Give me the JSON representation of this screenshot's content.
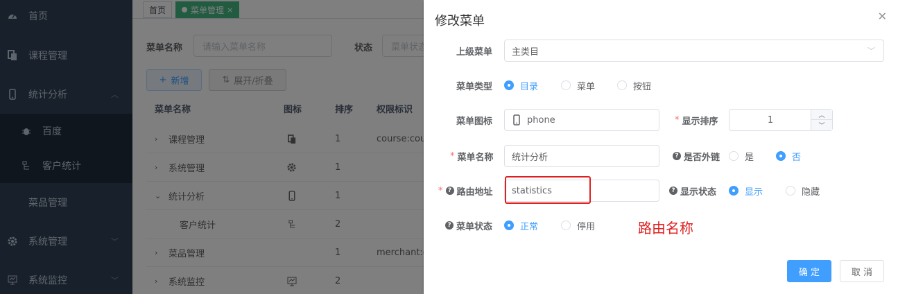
{
  "sidebar": {
    "items": [
      {
        "label": "首页",
        "icon": "dashboard-icon"
      },
      {
        "label": "课程管理",
        "icon": "copy-icon"
      },
      {
        "label": "统计分析",
        "icon": "phone-icon",
        "expanded": true
      },
      {
        "label": "百度",
        "icon": "bug-icon"
      },
      {
        "label": "客户统计",
        "icon": "tree-icon"
      },
      {
        "label": "菜品管理",
        "icon": ""
      },
      {
        "label": "系统管理",
        "icon": "gear-icon"
      },
      {
        "label": "系统监控",
        "icon": "monitor-icon"
      }
    ]
  },
  "tags": {
    "home": "首页",
    "current": "菜单管理"
  },
  "search": {
    "name_label": "菜单名称",
    "name_placeholder": "请输入菜单名称",
    "status_label": "状态",
    "status_placeholder": "菜单状态"
  },
  "toolbar": {
    "add": "新增",
    "expand": "展开/折叠"
  },
  "table": {
    "headers": [
      "菜单名称",
      "图标",
      "排序",
      "权限标识"
    ],
    "rows": [
      {
        "name": "课程管理",
        "icon": "copy-icon",
        "order": "1",
        "perm": "course:cou",
        "expand": ">"
      },
      {
        "name": "系统管理",
        "icon": "gear-icon",
        "order": "1",
        "perm": "",
        "expand": ">"
      },
      {
        "name": "统计分析",
        "icon": "phone-icon",
        "order": "1",
        "perm": "",
        "expand": "v"
      },
      {
        "name": "客户统计",
        "icon": "tree-icon",
        "order": "2",
        "perm": "",
        "expand": ""
      },
      {
        "name": "菜品管理",
        "icon": "",
        "order": "1",
        "perm": "merchant:c",
        "expand": ">"
      },
      {
        "name": "系统监控",
        "icon": "monitor-icon",
        "order": "2",
        "perm": "",
        "expand": ">"
      }
    ]
  },
  "dialog": {
    "title": "修改菜单",
    "parent_label": "上级菜单",
    "parent_value": "主类目",
    "type_label": "菜单类型",
    "type_options": [
      "目录",
      "菜单",
      "按钮"
    ],
    "type_selected": 0,
    "icon_label": "菜单图标",
    "icon_value": "phone",
    "order_label": "显示排序",
    "order_value": "1",
    "name_label": "菜单名称",
    "name_value": "统计分析",
    "external_label": "是否外链",
    "external_options": [
      "是",
      "否"
    ],
    "external_selected": 1,
    "path_label": "路由地址",
    "path_value": "statistics",
    "visible_label": "显示状态",
    "visible_options": [
      "显示",
      "隐藏"
    ],
    "visible_selected": 0,
    "status_label": "菜单状态",
    "status_options": [
      "正常",
      "停用"
    ],
    "status_selected": 0,
    "annotation": "路由名称",
    "ok": "确 定",
    "cancel": "取 消"
  },
  "colors": {
    "sidebar_bg": "#304156",
    "primary": "#409eff",
    "tag_active": "#42b983",
    "annotation": "#e02020"
  }
}
